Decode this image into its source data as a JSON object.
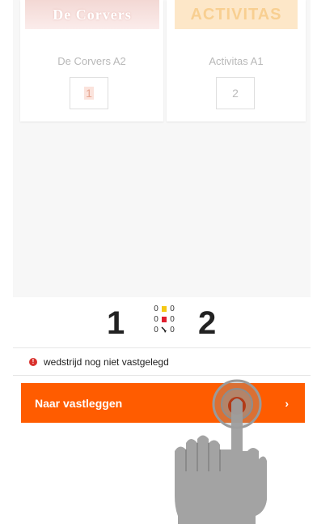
{
  "teams": {
    "home": {
      "logo_text": "De Corvers",
      "name": "De Corvers A2",
      "score": "1"
    },
    "away": {
      "logo_text": "ACTIVITAS",
      "name": "Activitas A1",
      "score": "2"
    }
  },
  "scoreboard": {
    "home_score": "1",
    "away_score": "2",
    "card_rows": [
      {
        "left": "0",
        "icon": "yellow-card",
        "right": "0"
      },
      {
        "left": "0",
        "icon": "red-card",
        "right": "0"
      },
      {
        "left": "0",
        "icon": "substitution",
        "right": "0"
      }
    ]
  },
  "status": {
    "icon": "alert-icon",
    "text": "wedstrijd nog niet vastgelegd"
  },
  "action": {
    "label": "Naar vastleggen",
    "chevron": "›"
  },
  "colors": {
    "accent": "#ff5c00",
    "alert": "#d9302c",
    "yellow_card": "#f5c814",
    "red_card": "#e01e2e"
  }
}
